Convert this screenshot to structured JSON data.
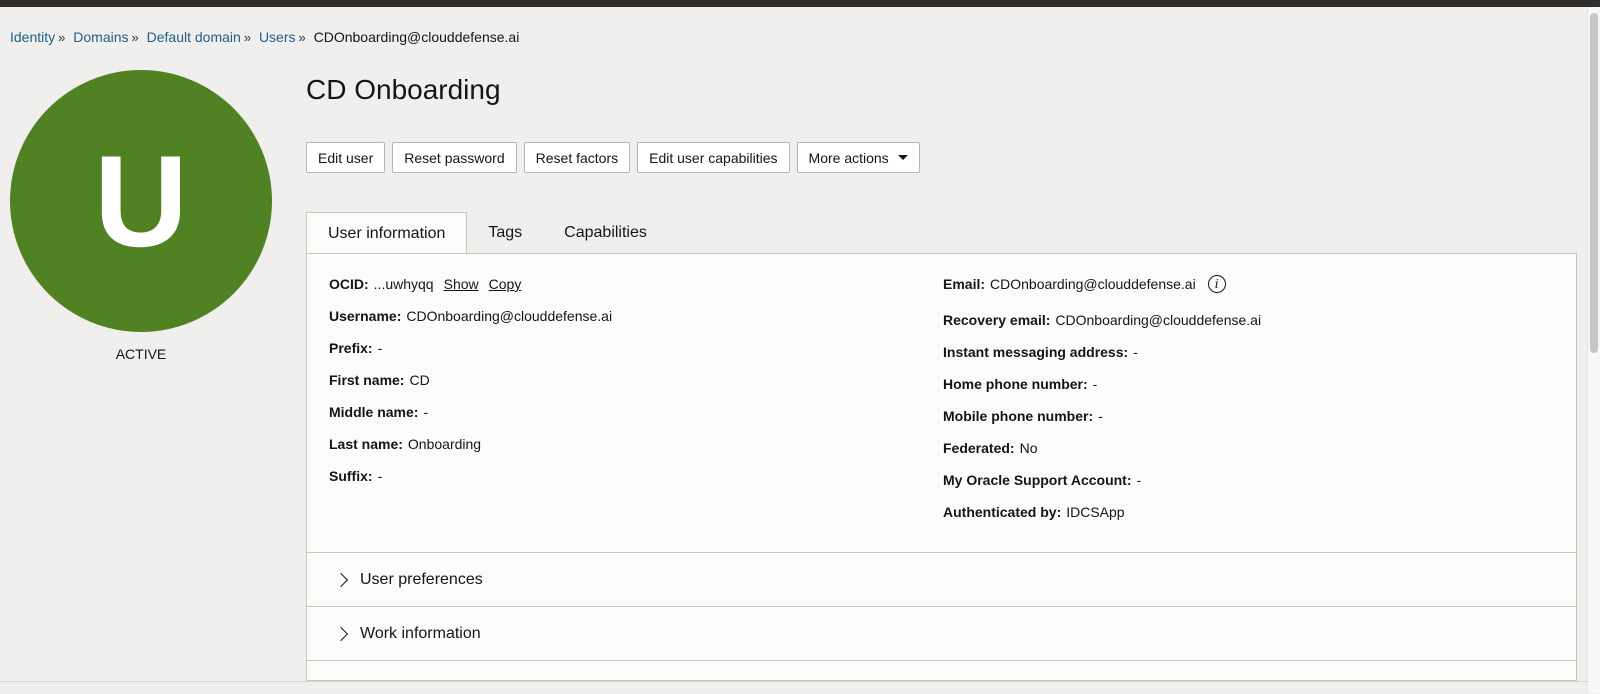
{
  "breadcrumb": {
    "items": [
      "Identity",
      "Domains",
      "Default domain",
      "Users"
    ],
    "separator": "»",
    "current": "CDOnboarding@clouddefense.ai"
  },
  "avatar": {
    "letter": "U",
    "color": "#508223"
  },
  "status": "ACTIVE",
  "title": "CD Onboarding",
  "actions": {
    "edit_user": "Edit user",
    "reset_password": "Reset password",
    "reset_factors": "Reset factors",
    "edit_capabilities": "Edit user capabilities",
    "more_actions": "More actions"
  },
  "tabs": {
    "user_info": "User information",
    "tags": "Tags",
    "capabilities": "Capabilities"
  },
  "info": {
    "ocid": {
      "label": "OCID:",
      "value": "...uwhyqq",
      "show": "Show",
      "copy": "Copy"
    },
    "username": {
      "label": "Username:",
      "value": "CDOnboarding@clouddefense.ai"
    },
    "prefix": {
      "label": "Prefix:",
      "value": "-"
    },
    "first_name": {
      "label": "First name:",
      "value": "CD"
    },
    "middle_name": {
      "label": "Middle name:",
      "value": "-"
    },
    "last_name": {
      "label": "Last name:",
      "value": "Onboarding"
    },
    "suffix": {
      "label": "Suffix:",
      "value": "-"
    },
    "email": {
      "label": "Email:",
      "value": "CDOnboarding@clouddefense.ai",
      "icon": "i"
    },
    "recovery_email": {
      "label": "Recovery email:",
      "value": "CDOnboarding@clouddefense.ai"
    },
    "im_address": {
      "label": "Instant messaging address:",
      "value": "-"
    },
    "home_phone": {
      "label": "Home phone number:",
      "value": "-"
    },
    "mobile_phone": {
      "label": "Mobile phone number:",
      "value": "-"
    },
    "federated": {
      "label": "Federated:",
      "value": "No"
    },
    "mos_account": {
      "label": "My Oracle Support Account:",
      "value": "-"
    },
    "authenticated_by": {
      "label": "Authenticated by:",
      "value": "IDCSApp"
    }
  },
  "sections": {
    "user_preferences": "User preferences",
    "work_information": "Work information"
  }
}
